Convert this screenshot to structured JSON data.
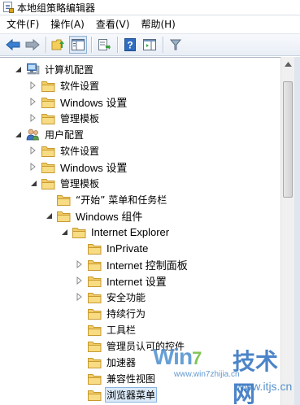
{
  "window": {
    "title": "本地组策略编辑器"
  },
  "menubar": {
    "items": [
      {
        "label": "文件(F)"
      },
      {
        "label": "操作(A)"
      },
      {
        "label": "查看(V)"
      },
      {
        "label": "帮助(H)"
      }
    ]
  },
  "toolbar": {
    "buttons": [
      "back-icon",
      "forward-icon",
      "up-folder-icon",
      "show-hide-tree-icon",
      "export-list-icon",
      "help-icon",
      "properties-pane-icon",
      "filter-icon"
    ]
  },
  "tree": {
    "nodes": [
      {
        "label": "计算机配置",
        "icon": "computer-icon",
        "expander": "expanded"
      },
      {
        "label": "软件设置",
        "icon": "folder-icon",
        "expander": "collapsed"
      },
      {
        "label": "Windows 设置",
        "icon": "folder-icon",
        "expander": "collapsed"
      },
      {
        "label": "管理模板",
        "icon": "folder-icon",
        "expander": "collapsed"
      },
      {
        "label": "用户配置",
        "icon": "user-icon",
        "expander": "expanded"
      },
      {
        "label": "软件设置",
        "icon": "folder-icon",
        "expander": "collapsed"
      },
      {
        "label": "Windows 设置",
        "icon": "folder-icon",
        "expander": "collapsed"
      },
      {
        "label": "管理模板",
        "icon": "folder-icon",
        "expander": "expanded"
      },
      {
        "label": "“开始” 菜单和任务栏",
        "icon": "folder-icon",
        "expander": "none"
      },
      {
        "label": "Windows 组件",
        "icon": "folder-icon",
        "expander": "expanded"
      },
      {
        "label": "Internet Explorer",
        "icon": "folder-icon",
        "expander": "expanded"
      },
      {
        "label": "InPrivate",
        "icon": "folder-icon",
        "expander": "none"
      },
      {
        "label": "Internet 控制面板",
        "icon": "folder-icon",
        "expander": "collapsed"
      },
      {
        "label": "Internet 设置",
        "icon": "folder-icon",
        "expander": "collapsed"
      },
      {
        "label": "安全功能",
        "icon": "folder-icon",
        "expander": "collapsed"
      },
      {
        "label": "持续行为",
        "icon": "folder-icon",
        "expander": "none"
      },
      {
        "label": "工具栏",
        "icon": "folder-icon",
        "expander": "none"
      },
      {
        "label": "管理员认可的控件",
        "icon": "folder-icon",
        "expander": "none"
      },
      {
        "label": "加速器",
        "icon": "folder-icon",
        "expander": "none"
      },
      {
        "label": "兼容性视图",
        "icon": "folder-icon",
        "expander": "none"
      },
      {
        "label": "浏览器菜单",
        "icon": "folder-icon",
        "expander": "none",
        "selected": true
      }
    ]
  },
  "watermark": {
    "logo": "Win7",
    "brand": "技术网",
    "url_small": "www.win7zhijia.cn",
    "url": "www.itjs.cn"
  }
}
